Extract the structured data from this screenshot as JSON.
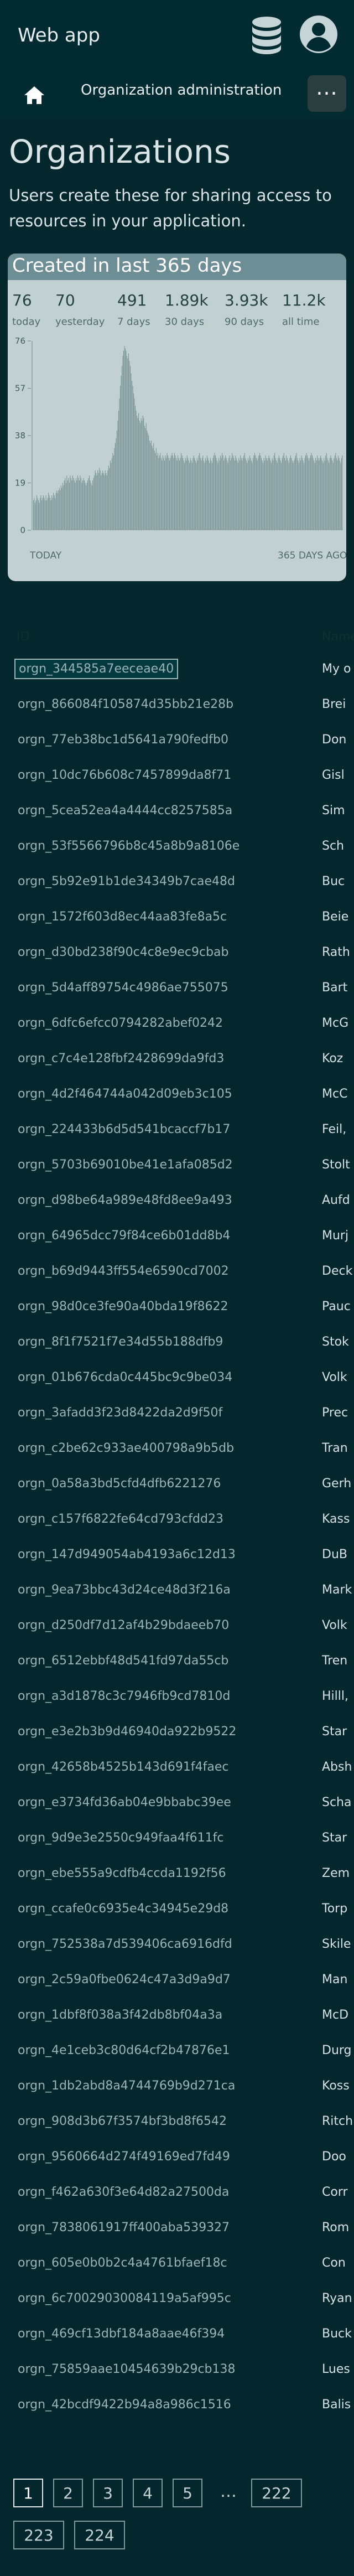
{
  "app": {
    "title": "Web app",
    "database_icon": "database-icon",
    "account_icon": "account-icon"
  },
  "tabs": {
    "home_icon": "home-icon",
    "active_tab": "Organization administration",
    "more_label": "···"
  },
  "page": {
    "title": "Organizations",
    "description": "Users create these for sharing access to resources in your application."
  },
  "stats": {
    "title": "Created in last 365 days",
    "items": [
      {
        "value": "76",
        "label": "today"
      },
      {
        "value": "70",
        "label": "yesterday"
      },
      {
        "value": "491",
        "label": "7 days"
      },
      {
        "value": "1.89k",
        "label": "30 days"
      },
      {
        "value": "3.93k",
        "label": "90 days"
      },
      {
        "value": "11.2k",
        "label": "all time"
      }
    ]
  },
  "chart_data": {
    "type": "bar",
    "title": "Created in last 365 days",
    "xlabel": "",
    "ylabel": "",
    "ylim": [
      0,
      76
    ],
    "yticks": [
      0,
      19,
      38,
      57,
      76
    ],
    "x_start_label": "TODAY",
    "x_end_label": "365 DAYS AGO",
    "grid": false,
    "series_color": "#6f8a8e",
    "values": [
      12,
      13,
      11,
      12,
      14,
      13,
      12,
      11,
      13,
      14,
      12,
      13,
      14,
      13,
      12,
      14,
      12,
      13,
      15,
      14,
      13,
      12,
      14,
      13,
      15,
      14,
      13,
      15,
      16,
      15,
      16,
      17,
      16,
      18,
      17,
      19,
      18,
      20,
      21,
      19,
      22,
      20,
      21,
      19,
      22,
      21,
      20,
      22,
      21,
      20,
      19,
      21,
      20,
      22,
      21,
      20,
      22,
      21,
      19,
      20,
      21,
      20,
      19,
      18,
      19,
      20,
      21,
      22,
      20,
      19,
      18,
      20,
      21,
      22,
      24,
      23,
      22,
      24,
      23,
      25,
      24,
      22,
      23,
      24,
      23,
      22,
      24,
      23,
      22,
      24,
      26,
      25,
      28,
      27,
      29,
      31,
      30,
      33,
      35,
      37,
      40,
      44,
      48,
      53,
      58,
      62,
      66,
      70,
      72,
      74,
      73,
      72,
      70,
      69,
      71,
      68,
      66,
      63,
      60,
      58,
      55,
      53,
      50,
      48,
      46,
      45,
      47,
      44,
      43,
      45,
      44,
      46,
      45,
      42,
      41,
      43,
      40,
      39,
      38,
      36,
      35,
      36,
      34,
      33,
      35,
      32,
      31,
      33,
      30,
      31,
      29,
      30,
      31,
      29,
      28,
      30,
      29,
      28,
      30,
      29,
      31,
      30,
      29,
      28,
      29,
      30,
      31,
      30,
      29,
      31,
      30,
      29,
      28,
      30,
      29,
      28,
      29,
      31,
      30,
      29,
      28,
      27,
      29,
      28,
      30,
      29,
      28,
      27,
      29,
      28,
      27,
      29,
      30,
      29,
      28,
      27,
      29,
      28,
      30,
      31,
      29,
      28,
      29,
      30,
      28,
      27,
      29,
      28,
      30,
      29,
      28,
      27,
      29,
      28,
      27,
      29,
      30,
      31,
      30,
      29,
      28,
      27,
      29,
      28,
      30,
      29,
      31,
      30,
      28,
      29,
      30,
      29,
      28,
      27,
      29,
      30,
      28,
      29,
      31,
      30,
      29,
      28,
      30,
      29,
      28,
      27,
      29,
      28,
      30,
      29,
      28,
      29,
      30,
      31,
      29,
      28,
      27,
      29,
      28,
      30,
      29,
      28,
      27,
      29,
      30,
      31,
      30,
      29,
      28,
      29,
      30,
      31,
      30,
      29,
      28,
      27,
      29,
      28,
      30,
      29,
      28,
      29,
      30,
      29,
      28,
      27,
      29,
      28,
      30,
      31,
      29,
      28,
      27,
      29,
      30,
      29,
      28,
      27,
      29,
      30,
      31,
      29,
      28,
      30,
      29,
      28,
      27,
      29,
      30,
      29,
      28,
      27,
      28,
      29,
      30,
      31,
      29,
      28,
      27,
      29,
      28,
      30,
      29,
      28,
      27,
      29,
      30,
      31,
      30,
      29,
      28,
      29,
      30,
      31,
      30,
      29,
      28,
      27,
      29,
      28,
      30,
      29,
      28,
      29,
      30,
      29,
      28,
      27,
      29,
      28,
      30,
      31,
      29,
      28,
      27,
      29,
      30,
      29,
      28,
      27,
      29,
      30,
      31,
      29,
      28,
      30,
      29,
      28,
      27,
      29,
      30
    ]
  },
  "table": {
    "columns": [
      "ID",
      "Name"
    ],
    "rows": [
      {
        "id": "orgn_344585a7eeceae40",
        "name": "My o"
      },
      {
        "id": "orgn_866084f105874d35bb21e28b",
        "name": "Brei"
      },
      {
        "id": "orgn_77eb38bc1d5641a790fedfb0",
        "name": "Don"
      },
      {
        "id": "orgn_10dc76b608c7457899da8f71",
        "name": "Gisl"
      },
      {
        "id": "orgn_5cea52ea4a4444cc8257585a",
        "name": "Sim"
      },
      {
        "id": "orgn_53f5566796b8c45a8b9a8106e",
        "name": "Sch"
      },
      {
        "id": "orgn_5b92e91b1de34349b7cae48d",
        "name": "Buc"
      },
      {
        "id": "orgn_1572f603d8ec44aa83fe8a5c",
        "name": "Beie"
      },
      {
        "id": "orgn_d30bd238f90c4c8e9ec9cbab",
        "name": "Rath"
      },
      {
        "id": "orgn_5d4aff89754c4986ae755075",
        "name": "Bart"
      },
      {
        "id": "orgn_6dfc6efcc0794282abef0242",
        "name": "McG"
      },
      {
        "id": "orgn_c7c4e128fbf2428699da9fd3",
        "name": "Koz"
      },
      {
        "id": "orgn_4d2f464744a042d09eb3c105",
        "name": "McC"
      },
      {
        "id": "orgn_224433b6d5d541bcaccf7b17",
        "name": "Feil,"
      },
      {
        "id": "orgn_5703b69010be41e1afa085d2",
        "name": "Stolt"
      },
      {
        "id": "orgn_d98be64a989e48fd8ee9a493",
        "name": "Aufd"
      },
      {
        "id": "orgn_64965dcc79f84ce6b01dd8b4",
        "name": "Murj"
      },
      {
        "id": "orgn_b69d9443ff554e6590cd7002",
        "name": "Deck"
      },
      {
        "id": "orgn_98d0ce3fe90a40bda19f8622",
        "name": "Pauc"
      },
      {
        "id": "orgn_8f1f7521f7e34d55b188dfb9",
        "name": "Stok"
      },
      {
        "id": "orgn_01b676cda0c445bc9c9be034",
        "name": "Volk"
      },
      {
        "id": "orgn_3afadd3f23d8422da2d9f50f",
        "name": "Prec"
      },
      {
        "id": "orgn_c2be62c933ae400798a9b5db",
        "name": "Tran"
      },
      {
        "id": "orgn_0a58a3bd5cfd4dfb6221276",
        "name": "Gerh"
      },
      {
        "id": "orgn_c157f6822fe64cd793cfdd23",
        "name": "Kass"
      },
      {
        "id": "orgn_147d949054ab4193a6c12d13",
        "name": "DuB"
      },
      {
        "id": "orgn_9ea73bbc43d24ce48d3f216a",
        "name": "Mark"
      },
      {
        "id": "orgn_d250df7d12af4b29bdaeeb70",
        "name": "Volk"
      },
      {
        "id": "orgn_6512ebbf48d541fd97da55cb",
        "name": "Tren"
      },
      {
        "id": "orgn_a3d1878c3c7946fb9cd7810d",
        "name": "Hilll,"
      },
      {
        "id": "orgn_e3e2b3b9d46940da922b9522",
        "name": "Star"
      },
      {
        "id": "orgn_42658b4525b143d691f4faec",
        "name": "Absh"
      },
      {
        "id": "orgn_e3734fd36ab04e9bbabc39ee",
        "name": "Scha"
      },
      {
        "id": "orgn_9d9e3e2550c949faa4f611fc",
        "name": "Star"
      },
      {
        "id": "orgn_ebe555a9cdfb4ccda1192f56",
        "name": "Zem"
      },
      {
        "id": "orgn_ccafe0c6935e4c34945e29d8",
        "name": "Torp"
      },
      {
        "id": "orgn_752538a7d539406ca6916dfd",
        "name": "Skile"
      },
      {
        "id": "orgn_2c59a0fbe0624c47a3d9a9d7",
        "name": "Man"
      },
      {
        "id": "orgn_1dbf8f038a3f42db8bf04a3a",
        "name": "McD"
      },
      {
        "id": "orgn_4e1ceb3c80d64cf2b47876e1",
        "name": "Durg"
      },
      {
        "id": "orgn_1db2abd8a4744769b9d271ca",
        "name": "Koss"
      },
      {
        "id": "orgn_908d3b67f3574bf3bd8f6542",
        "name": "Ritch"
      },
      {
        "id": "orgn_9560664d274f49169ed7fd49",
        "name": "Doo"
      },
      {
        "id": "orgn_f462a630f3e64d82a27500da",
        "name": "Corr"
      },
      {
        "id": "orgn_7838061917ff400aba539327",
        "name": "Rom"
      },
      {
        "id": "orgn_605e0b0b2c4a4761bfaef18c",
        "name": "Con"
      },
      {
        "id": "orgn_6c70029030084119a5af995c",
        "name": "Ryan"
      },
      {
        "id": "orgn_469cf13dbf184a8aae46f394",
        "name": "Buck"
      },
      {
        "id": "orgn_75859aae10454639b29cb138",
        "name": "Lues"
      },
      {
        "id": "orgn_42bcdf9422b94a8a986c1516",
        "name": "Balis"
      }
    ]
  },
  "pagination": {
    "pages": [
      "1",
      "2",
      "3",
      "4",
      "5"
    ],
    "ellipsis": "…",
    "last_pages": [
      "222",
      "223",
      "224"
    ],
    "current": "1"
  }
}
